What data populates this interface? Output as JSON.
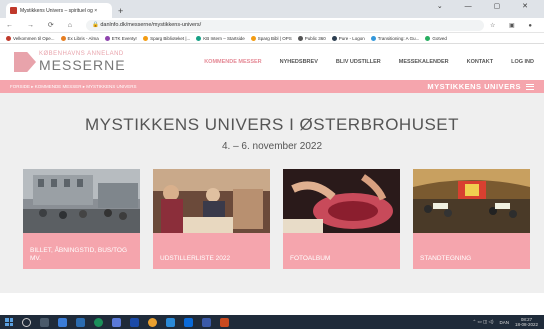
{
  "browser": {
    "tab_title": "Mystikkens Univers – spirituel og ×",
    "url": "danlnfo.dk/messerne/mystikkens-univers/",
    "bookmarks": [
      "Velkommen til Ope...",
      "Ex Libris - Alma",
      "ETK Eventyr",
      "Sparg Biblioteket |...",
      "KB Intern – Startside",
      "Sparg Bibl | OPS",
      "Public 360",
      "Pure - Logon",
      "Transitioning: A Gu...",
      "Gotved"
    ]
  },
  "site": {
    "logo_top": "KØBENHAVNS ANNELAND",
    "logo_main": "MESSERNE",
    "nav": [
      "KOMMENDE MESSER",
      "NYHEDSBREV",
      "BLIV UDSTILLER",
      "MESSEKALENDER",
      "KONTAKT",
      "LOG IND"
    ],
    "breadcrumb": "FORSIDE ▸ KOMMENDE MESSER ▸ MYSTIKKENS UNIVERS",
    "section_title": "MYSTIKKENS UNIVERS"
  },
  "main": {
    "title": "MYSTIKKENS UNIVERS I ØSTERBROHUSET",
    "dates": "4. – 6. november 2022",
    "cards": [
      {
        "caption": "BILLET, ÅBNINGSTID, BUS/TOG MV."
      },
      {
        "caption": "UDSTILLERLISTE 2022"
      },
      {
        "caption": "FOTOALBUM"
      },
      {
        "caption": "STANDTEGNING"
      }
    ]
  },
  "taskbar": {
    "lang": "DAN",
    "time": "08:27",
    "date": "18-08-2022"
  }
}
